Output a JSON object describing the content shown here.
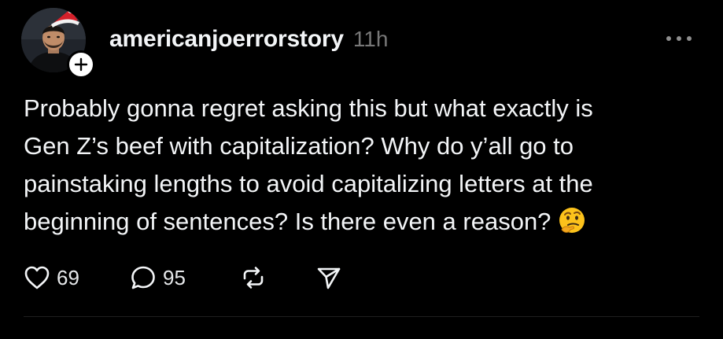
{
  "post": {
    "username": "americanjoerrorstory",
    "timestamp": "11h",
    "body_lines": [
      "Probably gonna regret asking this but what exactly is",
      "Gen Z’s beef with capitalization? Why do y’all go to",
      "painstaking lengths to avoid capitalizing letters at the",
      "beginning of sentences? Is there even a reason?"
    ],
    "trailing_emoji": "thinking-face-emoji",
    "avatar": "profile-photo-with-santa-hat",
    "follow_badge_icon": "plus-icon",
    "more_icon": "ellipsis-icon"
  },
  "actions": {
    "like_count": "69",
    "reply_count": "95",
    "like_icon": "heart-icon",
    "reply_icon": "speech-bubble-icon",
    "repost_icon": "repost-icon",
    "share_icon": "paper-plane-icon"
  },
  "colors": {
    "background": "#000000",
    "primary_text": "#f3f5f7",
    "secondary_text": "#777777",
    "icon": "#f3f5f7"
  }
}
